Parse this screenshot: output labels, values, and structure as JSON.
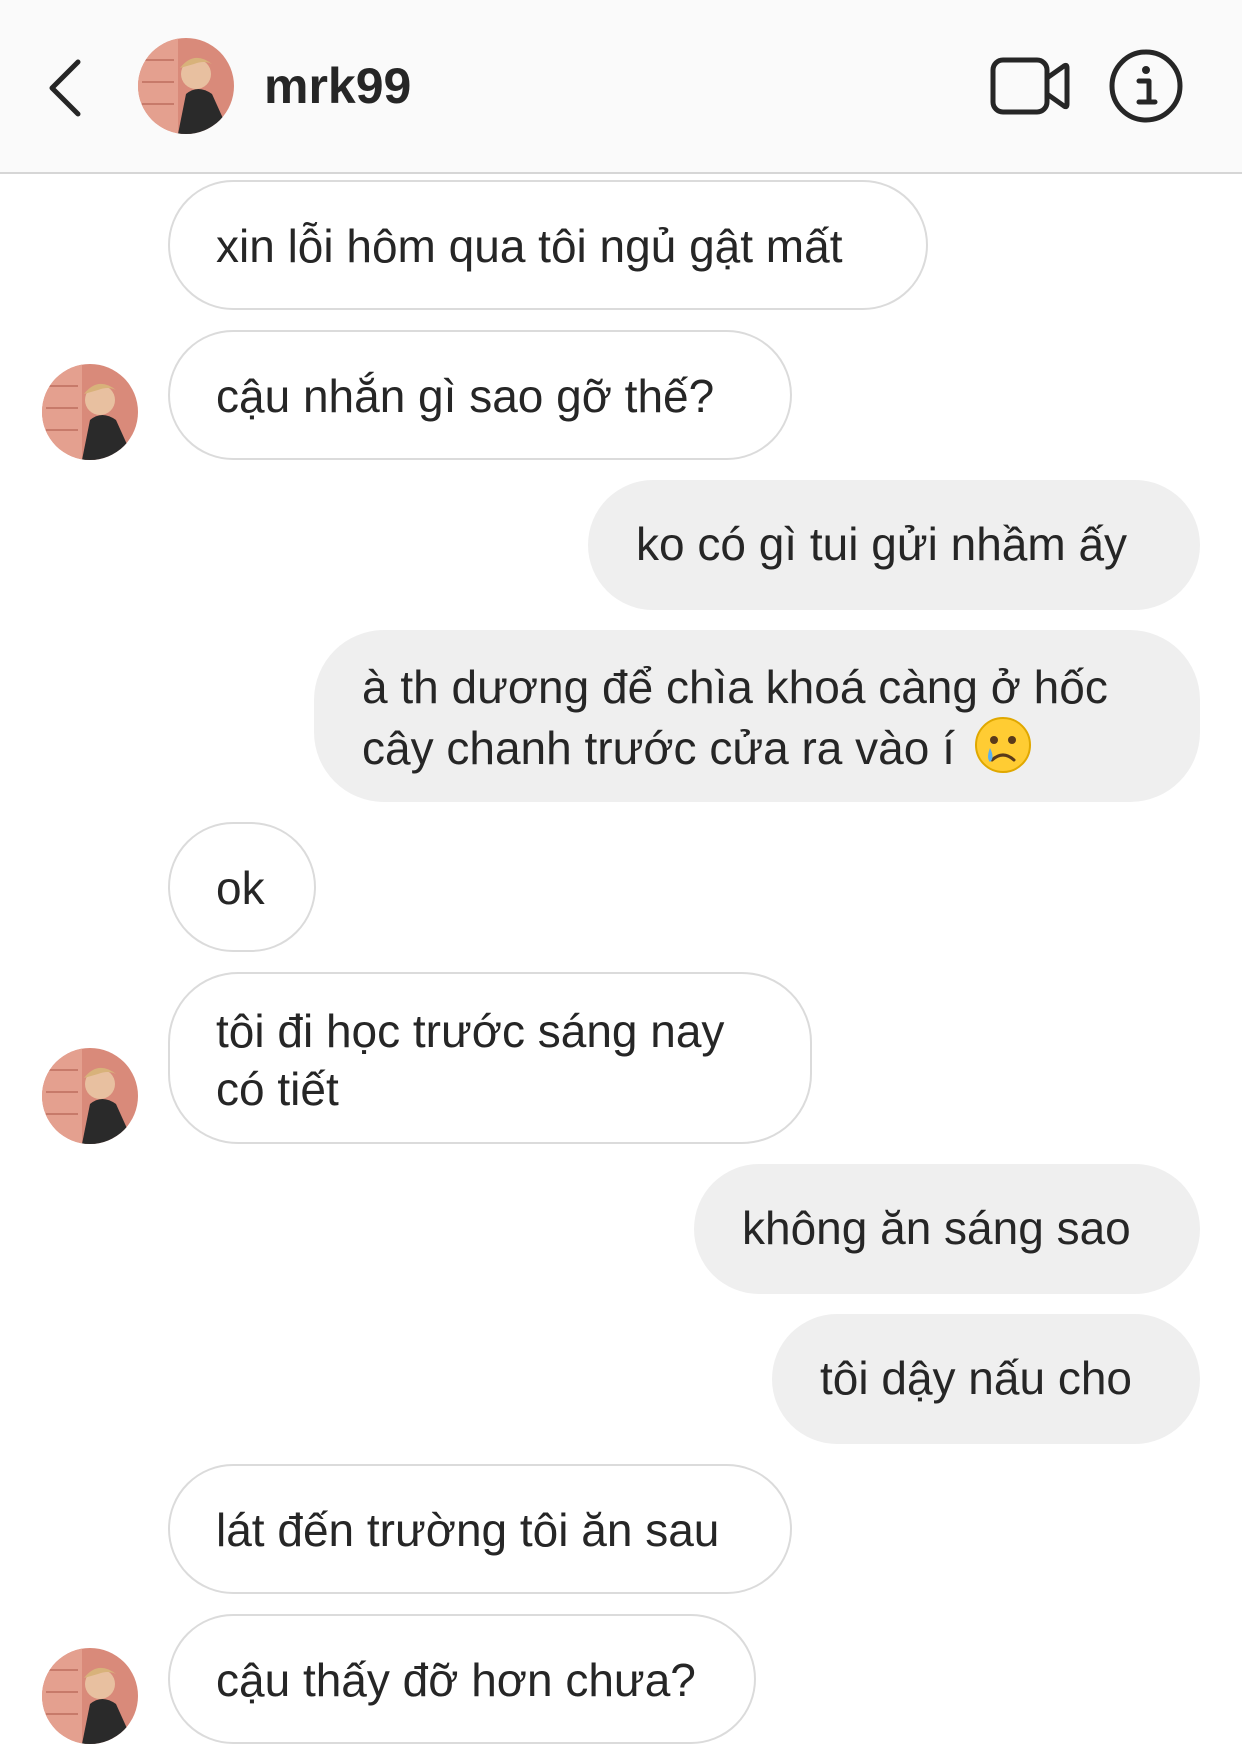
{
  "header": {
    "username": "mrk99",
    "back_icon": "chevron-left-icon",
    "video_icon": "video-camera-icon",
    "info_icon": "info-icon"
  },
  "colors": {
    "header_bg": "#fafafa",
    "incoming_bubble_bg": "#ffffff",
    "incoming_bubble_border": "#dbdbdb",
    "outgoing_bubble_bg": "#efefef",
    "text": "#262626"
  },
  "messages": [
    {
      "from": "them",
      "text": "xin lỗi hôm qua tôi ngủ gật mất"
    },
    {
      "from": "them",
      "text": "cậu nhắn gì sao gỡ thế?"
    },
    {
      "from": "me",
      "text": "ko có gì tui gửi nhầm ấy"
    },
    {
      "from": "me",
      "text": "à th dương để chìa khoá càng ở hốc\ncây chanh trước cửa ra vào í",
      "emoji": "crying-face-emoji"
    },
    {
      "from": "them",
      "text": "ok"
    },
    {
      "from": "them",
      "text": "tôi đi học trước sáng nay\ncó tiết"
    },
    {
      "from": "me",
      "text": "không ăn sáng sao"
    },
    {
      "from": "me",
      "text": "tôi dậy nấu cho"
    },
    {
      "from": "them",
      "text": "lát đến trường tôi ăn sau"
    },
    {
      "from": "them",
      "text": "cậu thấy đỡ hơn chưa?"
    }
  ]
}
